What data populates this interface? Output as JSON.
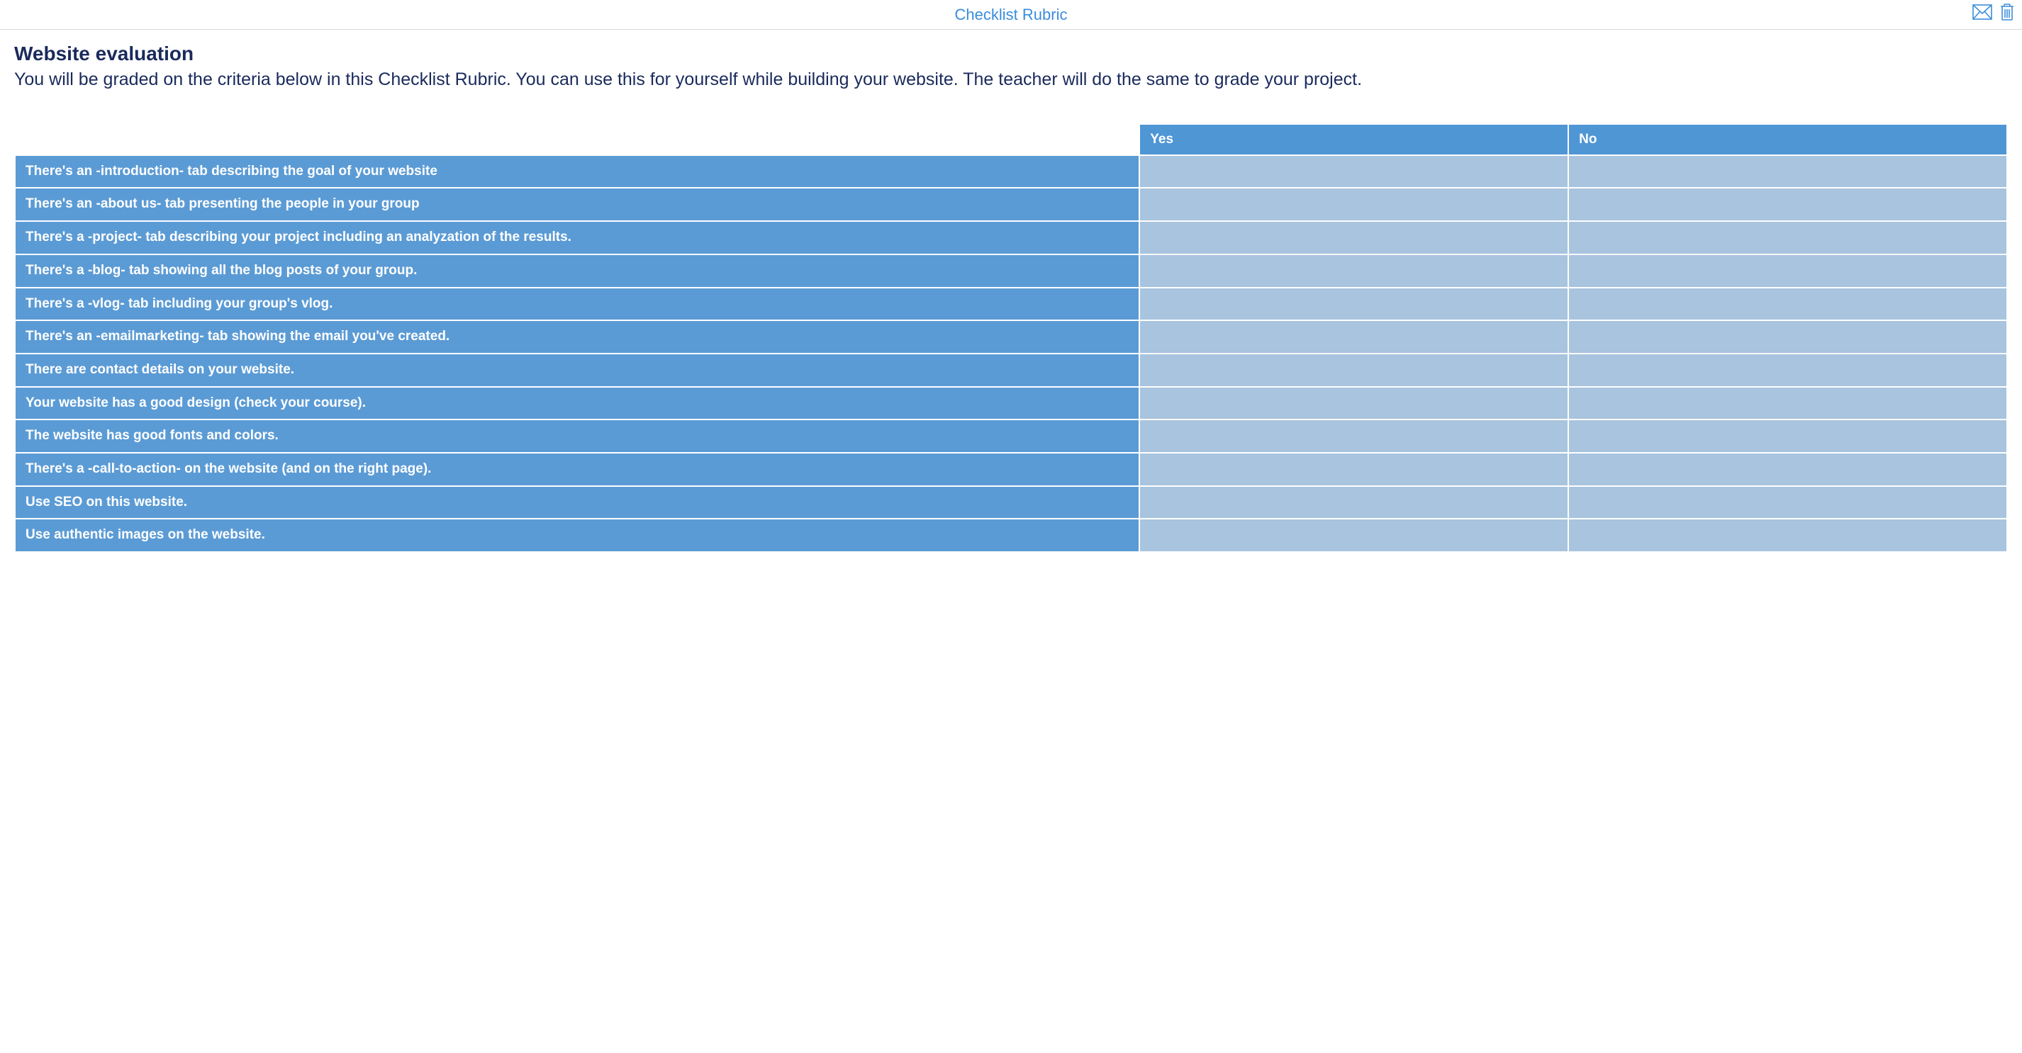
{
  "header": {
    "title": "Checklist Rubric"
  },
  "main": {
    "title": "Website evaluation",
    "description": "You will be graded on the criteria below in this Checklist Rubric. You can use this for yourself while building your website. The teacher will do the same to grade your project."
  },
  "table": {
    "columns": {
      "yes": "Yes",
      "no": "No"
    },
    "rows": [
      "There's an -introduction- tab describing the goal of your website",
      "There's an -about us- tab presenting the people in your group",
      "There's a -project- tab describing your project including an analyzation of the results.",
      "There's a -blog- tab showing all the blog posts of your group.",
      "There's a -vlog- tab including your group's vlog.",
      "There's an -emailmarketing- tab showing the email you've created.",
      "There are contact details on your website.",
      "Your website has a good design (check your course).",
      "The website has good fonts and colors.",
      "There's a -call-to-action- on the website (and on the right page).",
      "Use SEO on this website.",
      "Use authentic images on the website."
    ]
  }
}
